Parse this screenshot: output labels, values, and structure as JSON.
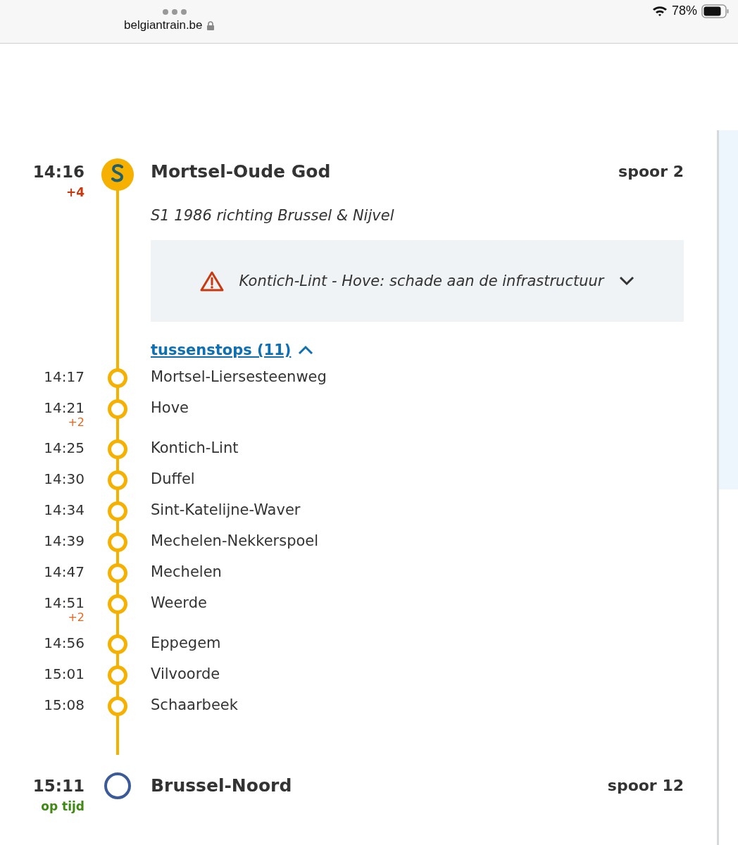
{
  "browser": {
    "url": "belgiantrain.be",
    "battery": "78%"
  },
  "origin": {
    "time": "14:16",
    "delay": "+4",
    "station": "Mortsel-Oude God",
    "platform": "spoor 2",
    "train": "S1 1986 richting Brussel & Nijvel"
  },
  "alert": {
    "text": "Kontich-Lint - Hove: schade aan de infrastructuur",
    "expanded": false
  },
  "intermediate": {
    "label": "tussenstops (11)",
    "expanded": true
  },
  "stops": [
    {
      "time": "14:17",
      "name": "Mortsel-Liersesteenweg"
    },
    {
      "time": "14:21",
      "delay": "+2",
      "name": "Hove"
    },
    {
      "time": "14:25",
      "name": "Kontich-Lint"
    },
    {
      "time": "14:30",
      "name": "Duffel"
    },
    {
      "time": "14:34",
      "name": "Sint-Katelijne-Waver"
    },
    {
      "time": "14:39",
      "name": "Mechelen-Nekkerspoel"
    },
    {
      "time": "14:47",
      "name": "Mechelen"
    },
    {
      "time": "14:51",
      "delay": "+2",
      "name": "Weerde"
    },
    {
      "time": "14:56",
      "name": "Eppegem"
    },
    {
      "time": "15:01",
      "name": "Vilvoorde"
    },
    {
      "time": "15:08",
      "name": "Schaarbeek"
    }
  ],
  "destination": {
    "time": "15:11",
    "status": "op tijd",
    "station": "Brussel-Noord",
    "platform": "spoor 12"
  }
}
